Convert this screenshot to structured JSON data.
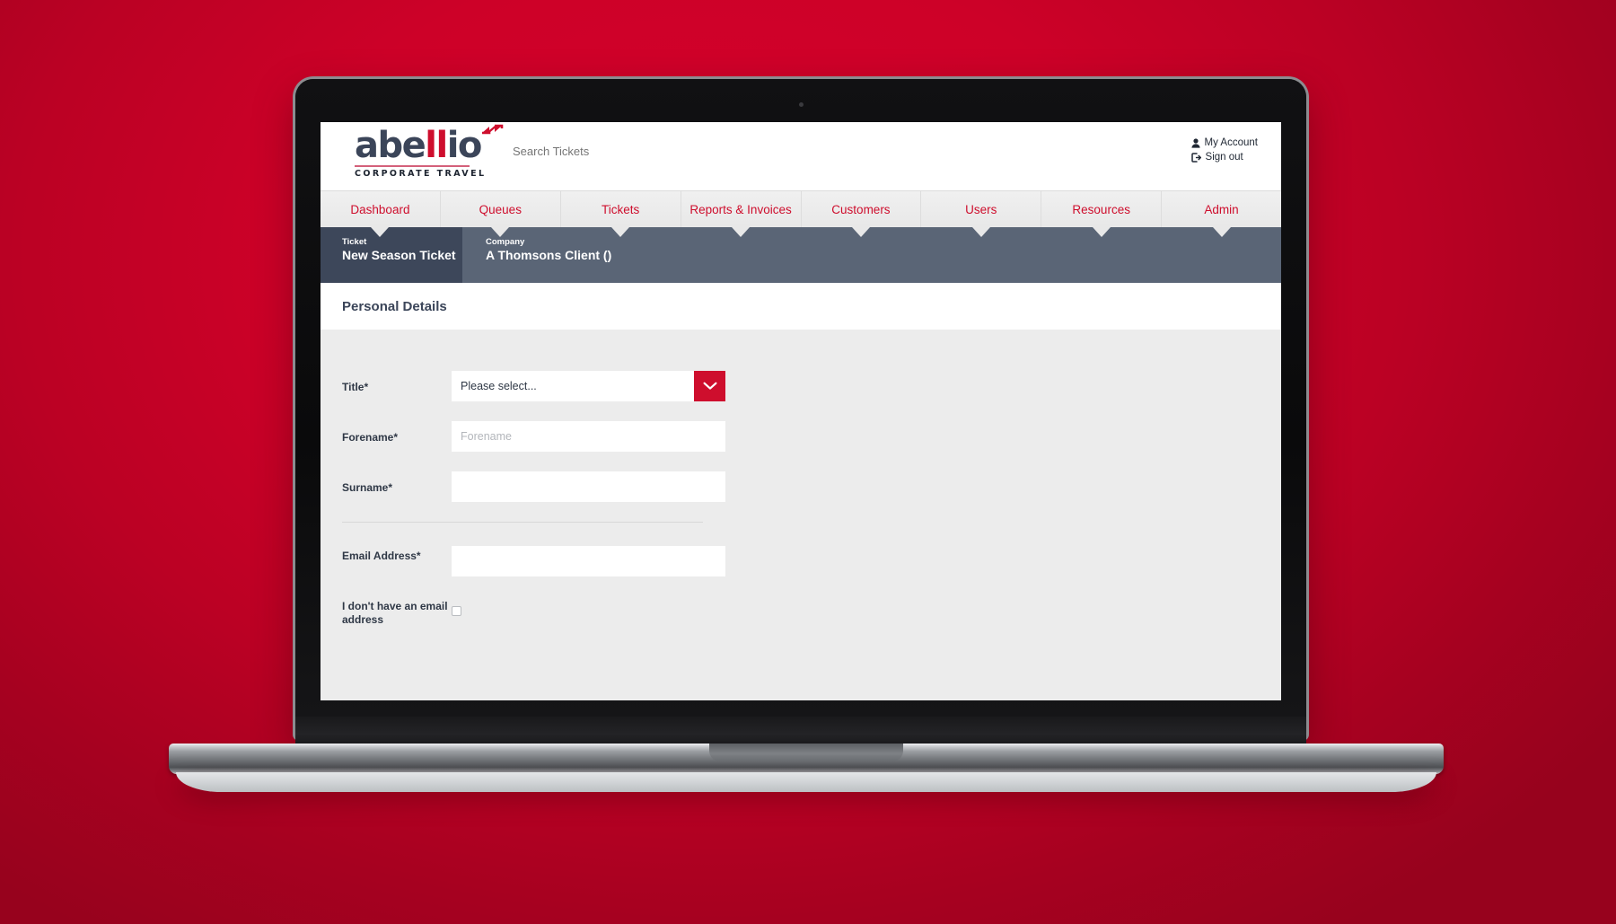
{
  "brand": {
    "logo_word": "abellio",
    "logo_word_red_part": "ll",
    "logo_tagline": "CORPORATE TRAVEL",
    "accent_red": "#ce0e2d",
    "slate": "#3b4559",
    "backdrop_red": "#c00226"
  },
  "header": {
    "search_placeholder": "Search Tickets",
    "search_value": "",
    "account_label": "My Account",
    "signout_label": "Sign out"
  },
  "nav": {
    "items": [
      {
        "label": "Dashboard"
      },
      {
        "label": "Queues"
      },
      {
        "label": "Tickets"
      },
      {
        "label": "Reports & Invoices"
      },
      {
        "label": "Customers"
      },
      {
        "label": "Users"
      },
      {
        "label": "Resources"
      },
      {
        "label": "Admin"
      }
    ]
  },
  "context": {
    "ticket_label": "Ticket",
    "ticket_value": "New Season Ticket",
    "company_label": "Company",
    "company_value": "A Thomsons Client ()"
  },
  "section": {
    "title": "Personal Details"
  },
  "form": {
    "title": {
      "label": "Title*",
      "selected": "Please select...",
      "options": [
        "Please select..."
      ]
    },
    "forename": {
      "label": "Forename*",
      "placeholder": "Forename",
      "value": ""
    },
    "surname": {
      "label": "Surname*",
      "placeholder": "",
      "value": ""
    },
    "email": {
      "label": "Email Address*",
      "placeholder": "",
      "value": ""
    },
    "no_email": {
      "label": "I don't have an email address",
      "checked": false
    }
  }
}
